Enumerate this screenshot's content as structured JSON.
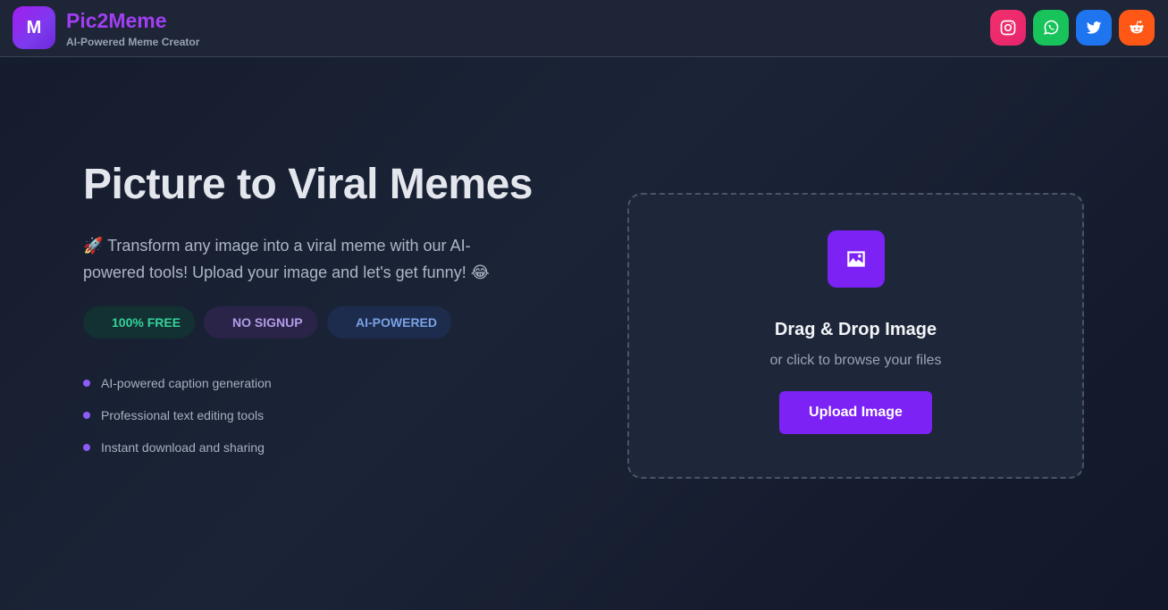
{
  "header": {
    "logo_letter": "M",
    "brand_name": "Pic2Meme",
    "tagline": "AI-Powered Meme Creator",
    "social": [
      {
        "name": "instagram",
        "icon": "instagram-icon",
        "color": "#e6246d"
      },
      {
        "name": "whatsapp",
        "icon": "whatsapp-icon",
        "color": "#17c35a"
      },
      {
        "name": "twitter",
        "icon": "twitter-icon",
        "color": "#1f74f0"
      },
      {
        "name": "reddit",
        "icon": "reddit-icon",
        "color": "#ff5715"
      }
    ]
  },
  "hero": {
    "title": "Picture to Viral Memes",
    "description": "🚀 Transform any image into a viral meme with our AI-powered tools! Upload your image and let's get funny! 😂",
    "badges": [
      "100% FREE",
      "NO SIGNUP",
      "AI-POWERED"
    ],
    "features": [
      "AI-powered caption generation",
      "Professional text editing tools",
      "Instant download and sharing"
    ]
  },
  "dropzone": {
    "icon": "image-icon",
    "title": "Drag & Drop Image",
    "subtitle": "or click to browse your files",
    "button_label": "Upload Image"
  },
  "colors": {
    "accent": "#7c22f5",
    "brand": "#a23ff2",
    "background": "#1b2437"
  }
}
